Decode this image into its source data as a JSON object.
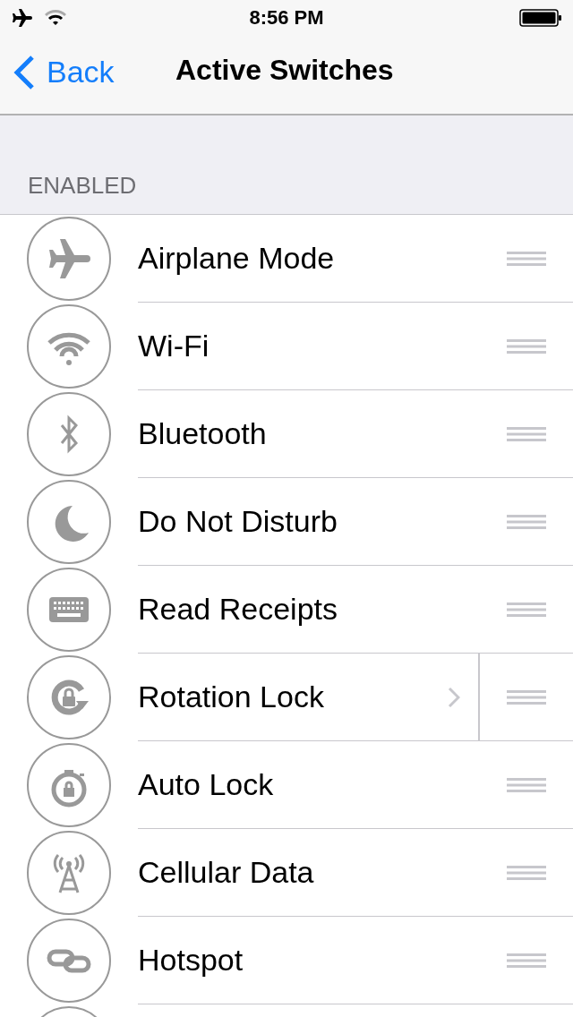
{
  "status_bar": {
    "time": "8:56 PM"
  },
  "nav": {
    "back": "Back",
    "title": "Active Switches"
  },
  "section": {
    "header": "ENABLED"
  },
  "items": [
    {
      "label": "Airplane Mode",
      "detail": false
    },
    {
      "label": "Wi-Fi",
      "detail": false
    },
    {
      "label": "Bluetooth",
      "detail": false
    },
    {
      "label": "Do Not Disturb",
      "detail": false
    },
    {
      "label": "Read Receipts",
      "detail": false
    },
    {
      "label": "Rotation Lock",
      "detail": true
    },
    {
      "label": "Auto Lock",
      "detail": false
    },
    {
      "label": "Cellular Data",
      "detail": false
    },
    {
      "label": "Hotspot",
      "detail": false
    }
  ]
}
